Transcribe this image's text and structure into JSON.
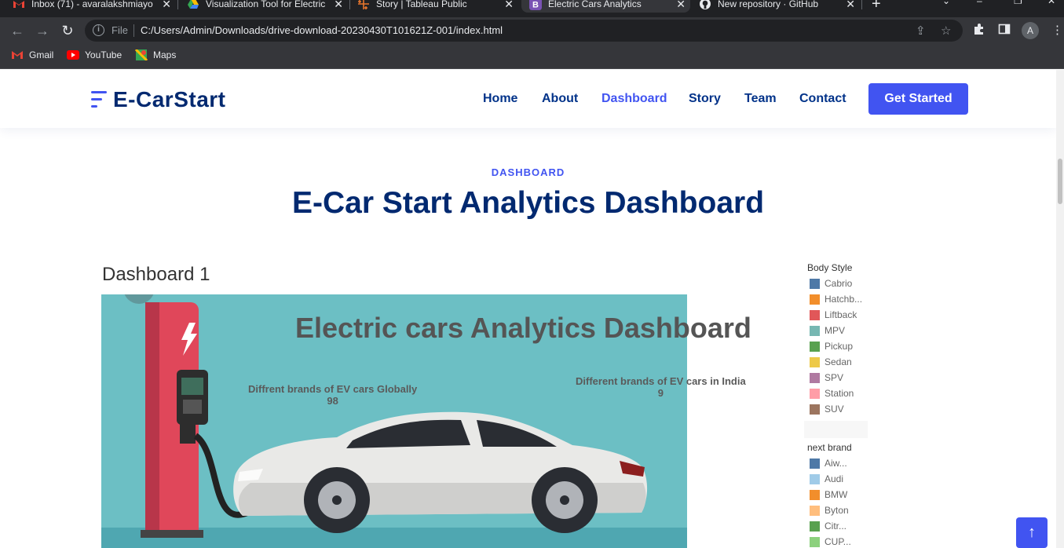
{
  "browser": {
    "tabs": [
      {
        "title": "Inbox (71) - avaralakshmiayo",
        "icon": "gmail-icon",
        "color": "#ea4335"
      },
      {
        "title": "Visualization Tool for Electric",
        "icon": "google-drive-icon",
        "color": "#fbbc04"
      },
      {
        "title": "Story | Tableau Public",
        "icon": "tableau-icon",
        "color": "#e8762d"
      },
      {
        "title": "Electric Cars Analytics",
        "icon": "bootstrap-icon",
        "color": "#7952b3"
      },
      {
        "title": "New repository · GitHub",
        "icon": "github-icon",
        "color": "#e8eaed"
      }
    ],
    "address": {
      "scheme_label": "File",
      "url": "C:/Users/Admin/Downloads/drive-download-20230430T101621Z-001/index.html"
    },
    "profile_initial": "A",
    "bookmarks": [
      {
        "label": "Gmail",
        "icon": "gmail-icon"
      },
      {
        "label": "YouTube",
        "icon": "youtube-icon"
      },
      {
        "label": "Maps",
        "icon": "maps-icon"
      }
    ]
  },
  "site": {
    "logo": "E-CarStart",
    "nav": [
      {
        "label": "Home",
        "active": false
      },
      {
        "label": "About",
        "active": false
      },
      {
        "label": "Dashboard",
        "active": true
      },
      {
        "label": "Story",
        "active": false
      },
      {
        "label": "Team",
        "active": false
      },
      {
        "label": "Contact",
        "active": false
      }
    ],
    "cta": "Get Started",
    "colors": {
      "accent": "#4154f1",
      "heading": "#012970"
    }
  },
  "section": {
    "label": "DASHBOARD",
    "title": "E-Car Start Analytics Dashboard"
  },
  "tableau": {
    "dashboard_name": "Dashboard 1",
    "viz_title": "Electric cars Analytics Dashboard",
    "kpis": [
      {
        "label": "Diffrent brands of EV cars Globally",
        "value": "98"
      },
      {
        "label": "Different brands of EV cars in India",
        "value": "9"
      }
    ],
    "legend_body_style": {
      "title": "Body Style",
      "items": [
        {
          "label": "Cabrio",
          "color": "#4e79a7"
        },
        {
          "label": "Hatchb...",
          "color": "#f28e2b"
        },
        {
          "label": "Liftback",
          "color": "#e15759"
        },
        {
          "label": "MPV",
          "color": "#76b7b2"
        },
        {
          "label": "Pickup",
          "color": "#59a14f"
        },
        {
          "label": "Sedan",
          "color": "#edc948"
        },
        {
          "label": "SPV",
          "color": "#b07aa1"
        },
        {
          "label": "Station",
          "color": "#ff9da7"
        },
        {
          "label": "SUV",
          "color": "#9c755f"
        }
      ]
    },
    "legend_brand": {
      "title": "next brand",
      "items": [
        {
          "label": "Aiw...",
          "color": "#4e79a7"
        },
        {
          "label": "Audi",
          "color": "#a0cbe8"
        },
        {
          "label": "BMW",
          "color": "#f28e2b"
        },
        {
          "label": "Byton",
          "color": "#ffbe7d"
        },
        {
          "label": "Citr...",
          "color": "#59a14f"
        },
        {
          "label": "CUP...",
          "color": "#8cd17d"
        }
      ]
    }
  },
  "scroll_top_icon": "arrow-up-icon"
}
